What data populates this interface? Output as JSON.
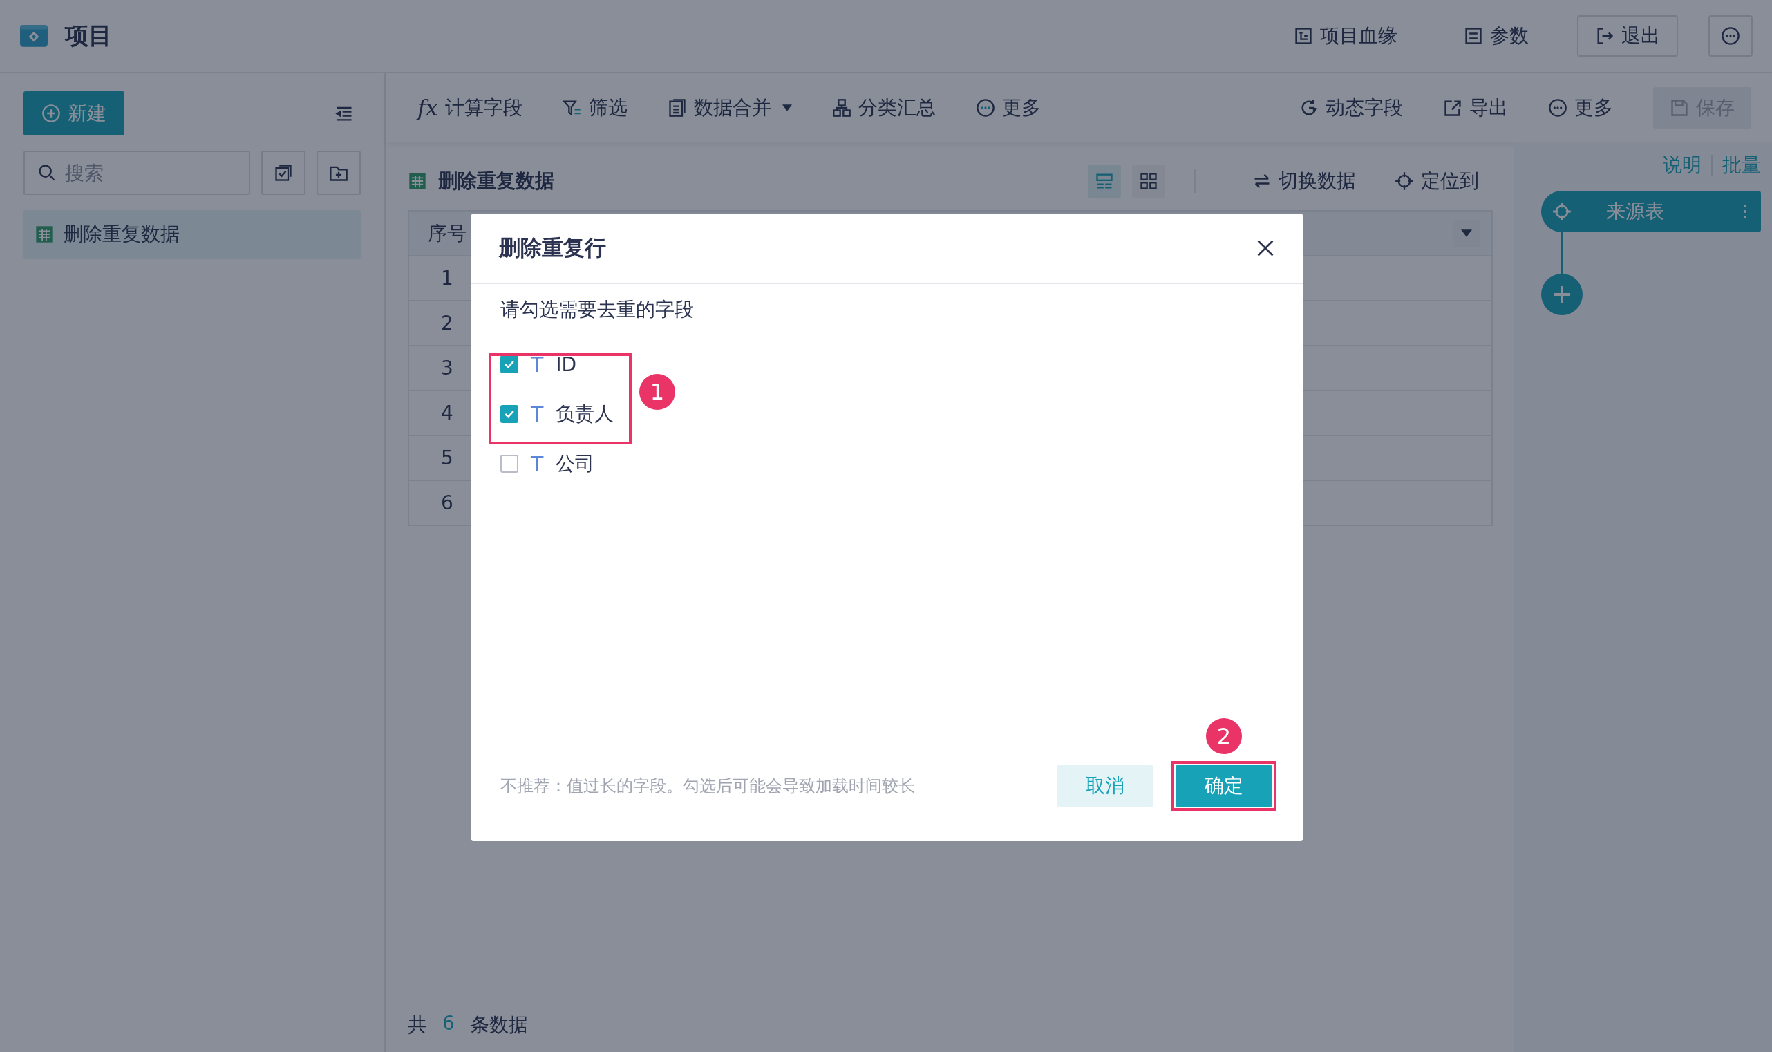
{
  "app": {
    "title": "项目"
  },
  "header_actions": [
    {
      "label": "项目血缘",
      "kind": "plain"
    },
    {
      "label": "参数",
      "kind": "plain"
    },
    {
      "label": "退出",
      "kind": "outlined"
    }
  ],
  "sidebar": {
    "new_button": "新建",
    "search": {
      "placeholder": "搜索"
    },
    "items": [
      {
        "label": "删除重复数据",
        "selected": true
      }
    ]
  },
  "toolbar": {
    "left": [
      {
        "label": "计算字段",
        "icon_text": "fx",
        "dropdown": false
      },
      {
        "label": "筛选",
        "dropdown": false
      },
      {
        "label": "数据合并",
        "dropdown": true
      },
      {
        "label": "分类汇总",
        "dropdown": false
      },
      {
        "label": "更多",
        "dropdown": false
      }
    ],
    "right": [
      {
        "label": "动态字段"
      },
      {
        "label": "导出"
      },
      {
        "label": "更多"
      }
    ],
    "save": {
      "label": "保存",
      "disabled": true
    }
  },
  "dataset": {
    "title": "删除重复数据",
    "view_modes": [
      {
        "selected": true
      },
      {
        "selected": false
      }
    ],
    "actions": [
      {
        "label": "切换数据"
      },
      {
        "label": "定位到"
      }
    ]
  },
  "table": {
    "columns": [
      "序号"
    ],
    "rows": [
      "1",
      "2",
      "3",
      "4",
      "5",
      "6"
    ]
  },
  "footer": {
    "prefix": "共",
    "count": "6",
    "suffix": "条数据"
  },
  "flow": {
    "links": [
      "说明",
      "批量"
    ],
    "node": {
      "label": "来源表"
    }
  },
  "dialog": {
    "title": "删除重复行",
    "prompt": "请勾选需要去重的字段",
    "fields": [
      {
        "type_glyph": "T",
        "name": "ID",
        "checked": true
      },
      {
        "type_glyph": "T",
        "name": "负责人",
        "checked": true
      },
      {
        "type_glyph": "T",
        "name": "公司",
        "checked": false
      }
    ],
    "note": "不推荐：值过长的字段。勾选后可能会导致加载时间较长",
    "cancel": "取消",
    "confirm": "确定"
  },
  "annotations": [
    {
      "label": "1"
    },
    {
      "label": "2"
    }
  ]
}
